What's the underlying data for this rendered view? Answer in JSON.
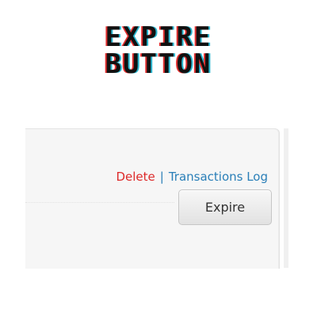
{
  "banner": {
    "line1": "EXPIRE",
    "line2": "BUTTON"
  },
  "panel": {
    "delete_label": "Delete",
    "separator": "|",
    "transactions_log_label": "Transactions Log",
    "expire_button_label": "Expire"
  },
  "colors": {
    "delete_link": "#dd2a2a",
    "link": "#2a7fb8",
    "banner_text": "#111111",
    "banner_shadow_red": "#e03030",
    "banner_shadow_cyan": "#29b6cf",
    "panel_bg": "#f6f6f6"
  }
}
